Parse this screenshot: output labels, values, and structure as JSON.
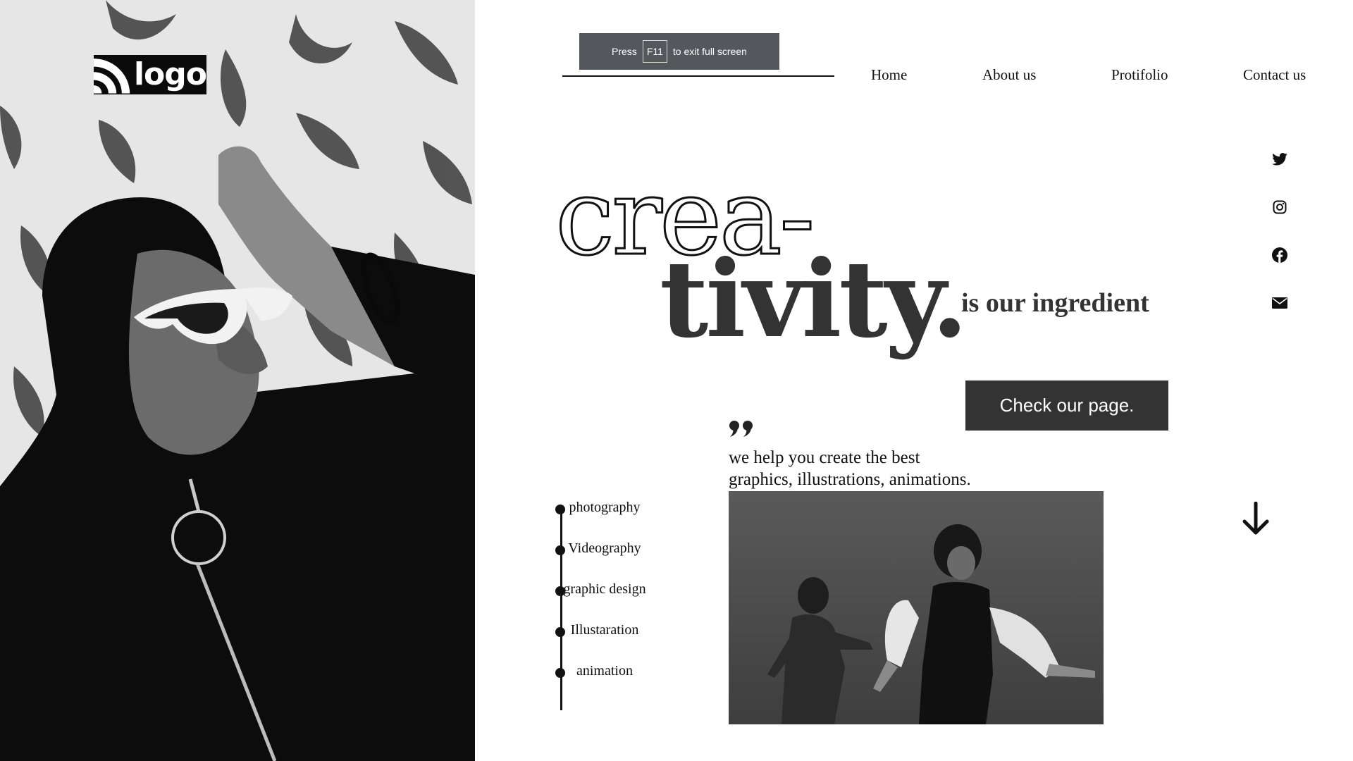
{
  "brand": {
    "logo_text": "logo"
  },
  "fullscreen_notice": {
    "press": "Press",
    "key": "F11",
    "suffix": "to exit full screen"
  },
  "nav": {
    "items": [
      {
        "label": "Home"
      },
      {
        "label": "About us"
      },
      {
        "label": "Protifolio"
      },
      {
        "label": "Contact us"
      }
    ]
  },
  "social": {
    "icons": [
      "twitter-icon",
      "instagram-icon",
      "facebook-icon",
      "mail-icon"
    ]
  },
  "hero": {
    "line1": "crea-",
    "line2": "tivity.",
    "subtitle": "is our ingredient",
    "cta_label": "Check our page."
  },
  "quote": {
    "text": "we help you create the best\ngraphics, illustrations, animations."
  },
  "services": {
    "items": [
      {
        "label": "photography"
      },
      {
        "label": "Videography"
      },
      {
        "label": "graphic design"
      },
      {
        "label": "Illustaration"
      },
      {
        "label": "animation"
      }
    ]
  },
  "colors": {
    "dark": "#333333",
    "black": "#111111",
    "notice_bg": "#54575c"
  }
}
